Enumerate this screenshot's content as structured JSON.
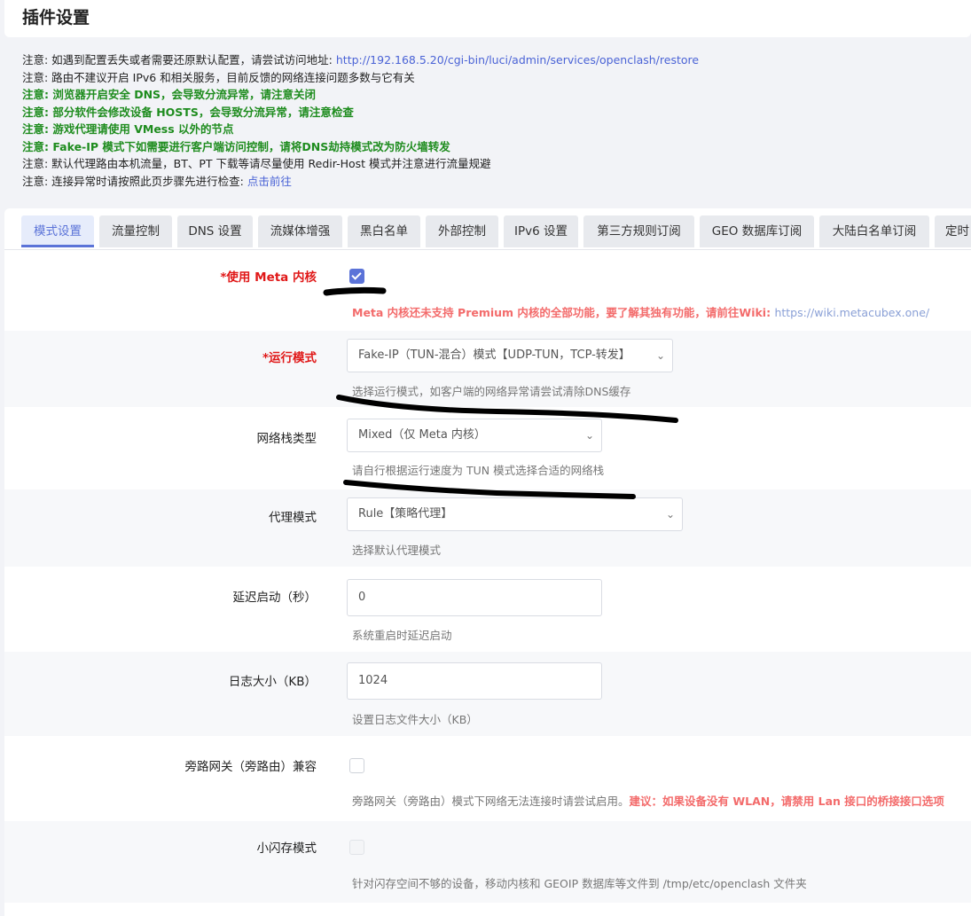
{
  "page_title": "插件设置",
  "notes": [
    {
      "text": "注意: 如遇到配置丢失或者需要还原默认配置，请尝试访问地址: ",
      "link": "http://192.168.5.20/cgi-bin/luci/admin/services/openclash/restore",
      "green": false
    },
    {
      "text": "注意: 路由不建议开启 IPv6 和相关服务，目前反馈的网络连接问题多数与它有关",
      "green": false
    },
    {
      "text": "注意: 浏览器开启安全 DNS，会导致分流异常，请注意关闭",
      "green": true
    },
    {
      "text": "注意: 部分软件会修改设备 HOSTS，会导致分流异常，请注意检查",
      "green": true
    },
    {
      "text": "注意: 游戏代理请使用 VMess 以外的节点",
      "green": true
    },
    {
      "text": "注意: Fake-IP 模式下如需要进行客户端访问控制，请将DNS劫持模式改为防火墙转发",
      "green": true
    },
    {
      "text": "注意: 默认代理路由本机流量，BT、PT 下载等请尽量使用 Redir-Host 模式并注意进行流量规避",
      "green": false
    },
    {
      "text": "注意: 连接异常时请按照此页步骤先进行检查: ",
      "link": "点击前往",
      "green": false
    }
  ],
  "tabs": [
    "模式设置",
    "流量控制",
    "DNS 设置",
    "流媒体增强",
    "黑白名单",
    "外部控制",
    "IPv6 设置",
    "第三方规则订阅",
    "GEO 数据库订阅",
    "大陆白名单订阅",
    "定时"
  ],
  "active_tab": "模式设置",
  "settings": {
    "meta_core": {
      "label": "*使用 Meta 内核",
      "checked": true,
      "hint_warn": "Meta 内核还未支持 Premium 内核的全部功能，要了解其独有功能，请前往Wiki: ",
      "hint_link": "https://wiki.metacubex.one/"
    },
    "run_mode": {
      "label": "*运行模式",
      "value": "Fake-IP（TUN-混合）模式【UDP-TUN，TCP-转发】",
      "hint": "选择运行模式，如客户端的网络异常请尝试清除DNS缓存"
    },
    "stack_type": {
      "label": "网络栈类型",
      "value": "Mixed（仅 Meta 内核）",
      "hint": "请自行根据运行速度为 TUN 模式选择合适的网络栈"
    },
    "proxy_mode": {
      "label": "代理模式",
      "value": "Rule【策略代理】",
      "hint": "选择默认代理模式"
    },
    "delay_start": {
      "label": "延迟启动（秒）",
      "value": "0",
      "hint": "系统重启时延迟启动"
    },
    "log_size": {
      "label": "日志大小（KB）",
      "value": "1024",
      "hint": "设置日志文件大小（KB）"
    },
    "bypass_gateway": {
      "label": "旁路网关（旁路由）兼容",
      "checked": false,
      "hint": "旁路网关（旁路由）模式下网络无法连接时请尝试启用。",
      "hint_warn": "建议：如果设备没有 WLAN，请禁用 Lan 接口的桥接接口选项"
    },
    "small_flash": {
      "label": "小闪存模式",
      "checked": false,
      "hint": "针对闪存空间不够的设备，移动内核和 GEOIP 数据库等文件到 /tmp/etc/openclash 文件夹"
    }
  },
  "colors": {
    "accent": "#5b73d8",
    "required_label": "#e01818",
    "warning_text": "#f36b6b",
    "note_green": "#1e8c1e",
    "annotation_ink": "#000000"
  }
}
